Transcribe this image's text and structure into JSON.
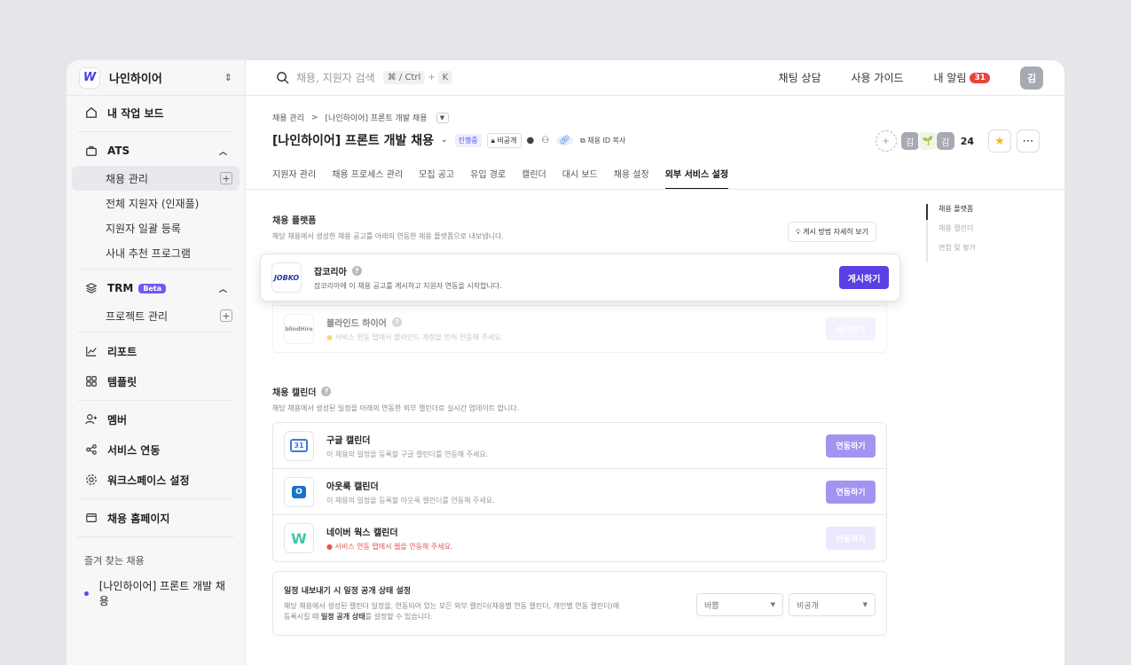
{
  "workspace": {
    "name": "나인하이어",
    "logo": "W"
  },
  "sidebar": {
    "my_board": "내 작업 보드",
    "ats": "ATS",
    "ats_items": [
      "채용 관리",
      "전체 지원자 (인재풀)",
      "지원자 일괄 등록",
      "사내 추천 프로그램"
    ],
    "trm": "TRM",
    "trm_badge": "Beta",
    "trm_items": [
      "프로젝트 관리"
    ],
    "report": "리포트",
    "template": "템플릿",
    "member": "멤버",
    "service": "서비스 연동",
    "workspace_settings": "워크스페이스 설정",
    "homepage": "채용 홈페이지",
    "fav_title": "즐겨 찾는 채용",
    "fav_items": [
      "[나인하이어] 프론트 개발 채용"
    ]
  },
  "topbar": {
    "search_placeholder": "채용, 지원자 검색",
    "kbd1": "⌘ / Ctrl",
    "plus": "+",
    "kbd2": "K",
    "chat": "채팅 상담",
    "guide": "사용 가이드",
    "alarm": "내 알림",
    "alarm_count": "31",
    "avatar": "김"
  },
  "header": {
    "breadcrumb_root": "채용 관리",
    "breadcrumb_sep": ">",
    "breadcrumb_current": "[나인하이어] 프론트 개발 채용",
    "title": "[나인하이어] 프론트 개발 채용",
    "status": "진행중",
    "privacy": "비공개",
    "copy_id": "채용 ID 복사",
    "members": [
      "김",
      "🌱",
      "김"
    ],
    "member_count": "24"
  },
  "tabs": [
    "지원자 관리",
    "채용 프로세스 관리",
    "모집 공고",
    "유입 경로",
    "캘린더",
    "대시 보드",
    "채용 설정",
    "외부 서비스 설정"
  ],
  "platform": {
    "title": "채용 플랫폼",
    "desc": "해당 채용에서 생성한 채용 공고를 아래의 연동한 채용 플랫폼으로 내보냅니다.",
    "howto": "게시 방법 자세히 보기",
    "items": [
      {
        "logo": "JOBKO",
        "name": "잡코리아",
        "desc": "잡코리아에 이 채용 공고를 게시하고 지원자 연동을 시작합니다.",
        "button": "게시하기"
      },
      {
        "logo": "blindHire",
        "name": "블라인드 하이어",
        "desc": "서비스 연동 탭에서 블라인드 계정을 먼저 연동해 주세요.",
        "button": "게시하기"
      }
    ]
  },
  "calendar": {
    "title": "채용 캘린더",
    "desc": "해당 채용에서 생성된 일정을 아래의 연동한 외부 캘린더로 실시간 업데이트 합니다.",
    "items": [
      {
        "logo": "31",
        "name": "구글 캘린더",
        "desc": "이 채용의 일정을 등록할 구글 캘린더를 연동해 주세요.",
        "button": "연동하기"
      },
      {
        "logo": "O",
        "name": "아웃룩 캘린더",
        "desc": "이 채용의 일정을 등록할 아웃룩 캘린더를 연동해 주세요.",
        "button": "연동하기"
      },
      {
        "logo": "W",
        "name": "네이버 웍스 캘린더",
        "desc": "서비스 연동 탭에서 웹을 연동해 주세요.",
        "button": "연동하기"
      }
    ],
    "export_title": "일정 내보내기 시 일정 공개 상태 설정",
    "export_desc_1": "해당 채용에서 생성된 캘린더 일정을, 연동되어 있는 모든 외부 캘린더(채용별 연동 캘린더, 개인별 연동 캘린더)에",
    "export_desc_2": "등록시킬 때",
    "export_desc_bold": "일정 공개 상태",
    "export_desc_3": "를 설정할 수 있습니다.",
    "select1": "바쁨",
    "select2": "비공개"
  },
  "toc": [
    "채용 플랫폼",
    "채용 캘린더",
    "면접 및 평가"
  ],
  "colors": {
    "primary": "#5b3fe5",
    "accent": "#a394f0"
  }
}
